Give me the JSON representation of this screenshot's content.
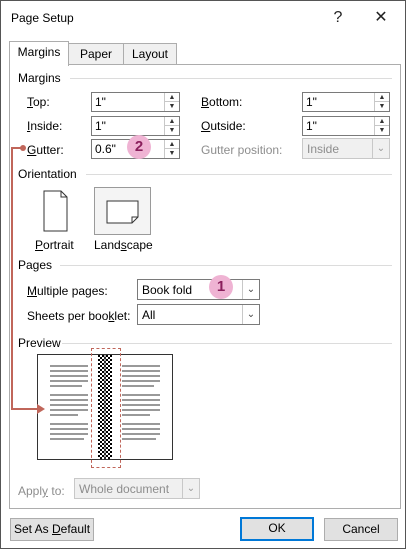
{
  "window": {
    "title": "Page Setup",
    "help_glyph": "?",
    "close_glyph": "✕"
  },
  "tabs": [
    {
      "label": "Margins",
      "active": true
    },
    {
      "label": "Paper",
      "active": false
    },
    {
      "label": "Layout",
      "active": false
    }
  ],
  "margins": {
    "group_label": "Margins",
    "top": {
      "label_key": "T",
      "label_rest": "op:",
      "value": "1\""
    },
    "bottom": {
      "label_key": "B",
      "label_rest": "ottom:",
      "value": "1\""
    },
    "inside": {
      "label_key": "I",
      "label_rest": "nside:",
      "value": "1\""
    },
    "outside": {
      "label_key": "O",
      "label_rest": "utside:",
      "value": "1\""
    },
    "gutter": {
      "label_key": "G",
      "label_rest": "utter:",
      "value": "0.6\""
    },
    "gutter_position": {
      "label": "Gutter position:",
      "value": "Inside"
    }
  },
  "orientation": {
    "group_label": "Orientation",
    "portrait": {
      "label_key": "P",
      "label_rest": "ortrait"
    },
    "landscape": {
      "label_pre": "Land",
      "label_key": "s",
      "label_rest": "cape",
      "selected": true
    }
  },
  "pages": {
    "group_label": "Pages",
    "multiple_pages": {
      "label_key": "M",
      "label_rest": "ultiple pages:",
      "value": "Book fold"
    },
    "sheets_per_booklet": {
      "label_pre": "Sheets per boo",
      "label_key": "k",
      "label_rest": "let:",
      "value": "All"
    }
  },
  "preview": {
    "group_label": "Preview"
  },
  "apply_to": {
    "label_pre": "Appl",
    "label_key": "y",
    "label_rest": " to:",
    "value": "Whole document"
  },
  "buttons": {
    "set_default_pre": "Set As ",
    "set_default_key": "D",
    "set_default_rest": "efault",
    "ok": "OK",
    "cancel": "Cancel"
  },
  "callouts": {
    "one": "1",
    "two": "2"
  },
  "colors": {
    "accent": "#0078d7",
    "callout_bg": "#efb3d3",
    "callout_fg": "#8a1f5c",
    "annotation": "#c0665a"
  }
}
